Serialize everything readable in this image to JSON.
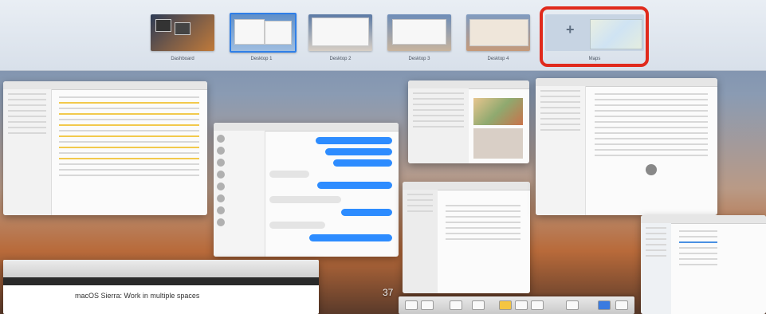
{
  "spaces": {
    "items": [
      {
        "label": "Dashboard"
      },
      {
        "label": "Desktop 1"
      },
      {
        "label": "Desktop 2"
      },
      {
        "label": "Desktop 3"
      },
      {
        "label": "Desktop 4"
      },
      {
        "label": "Maps"
      }
    ],
    "add_symbol": "+"
  },
  "windows": {
    "keynote_caption": "macOS Sierra: Work in multiple spaces",
    "page_number": "37"
  },
  "colors": {
    "highlight": "#e02a1c",
    "selected_space": "#2f7fe8"
  }
}
